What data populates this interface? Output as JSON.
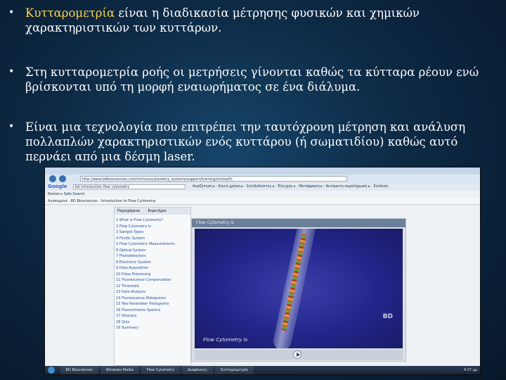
{
  "bullets": [
    {
      "highlight": "Κυτταρομετρία",
      "text": " είναι η  διαδικασία μέτρησης  φυσικών και χημικών χαρακτηριστικών των κυττάρων."
    },
    {
      "highlight": "",
      "text": "Στη κυτταρομετρία ροής οι μετρήσεις γίνονται καθώς τα κύτταρα ρέουν ενώ βρίσκονται υπό τη μορφή εναιωρήματος σε ένα διάλυμα."
    },
    {
      "highlight": "",
      "text": "Είναι μια τεχνολογία που επιτρέπει την ταυτόχρονη μέτρηση και ανάλυση πολλαπλών χαρακτηριστικών ενός κυττάρου (ή σωματιδίου) καθώς αυτό περνάει από μια δέσμη laser."
    }
  ],
  "bullet_symbol": "•",
  "colors": {
    "highlight": "#ffd34d",
    "text": "#ffffff",
    "background": "#0d2a45"
  },
  "screenshot": {
    "url": "http://www.bdbiosciences.com/immunocytometry_systems/support/training/online/ifc",
    "search_query": "bd introduction flow cytometry",
    "google_label": "Google",
    "gbar_items": "Αναζήτηση ▸  ·  Κοινή χρήση ▸  ·  Σελιδοδείκτες ▸  ·  Έλεγχος ▸  ·  Μετάφραση ▸  ·  Αυτόματη συμπλήρωση ▸  ·  Σύνδεση",
    "toolbar_items": "Norton ▸   Safe Search",
    "favorites": "Αγαπημένα   ·   BD Biosciences - Introduction to Flow Cytometry",
    "left_tabs": [
      "Περιεχόμενα",
      "Ευρετήριο"
    ],
    "outline": [
      "1 What is Flow Cytometry?",
      "2 Flow Cytometry Is",
      "3 Sample Types",
      "4 Fluidic System",
      "5 Flow Cytometric Measurements",
      "6 Optical System",
      "7 Photodetectors",
      "8 Electronic System",
      "9 Data Acquisition",
      "10 Pulse Processing",
      "11 Fluorescence Compensation",
      "12 Threshold",
      "13 Data Analysis",
      "14 Fluorescence Histograms",
      "15 Two-Parameter Histograms",
      "16 Fluorochrome Spectra",
      "17 Glossary",
      "18 Quiz",
      "19 Summary"
    ],
    "player_title": "Flow Cytometry Is",
    "video_caption": "Flow Cytometry Is",
    "bd_logo": "BD",
    "taskbar_tasks": [
      "BD Biosciences",
      "Windows Media",
      "Flow Cytometry",
      "Διαφάνειες",
      "Κυτταρομετρία"
    ],
    "clock": "4:37 μμ"
  }
}
